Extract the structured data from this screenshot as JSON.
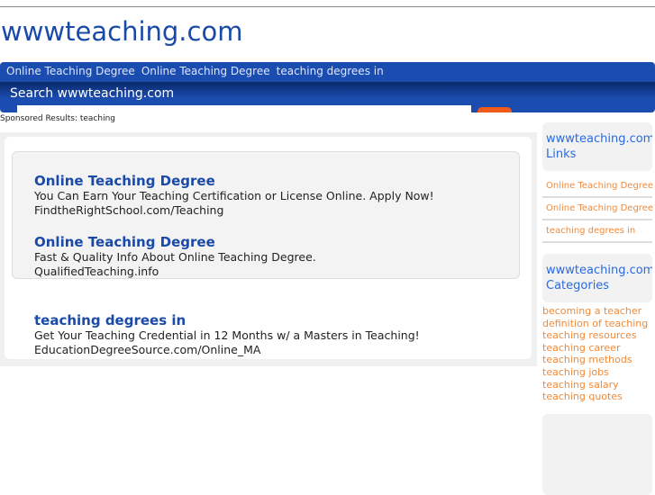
{
  "site_title": "wwwteaching.com",
  "nav": [
    "Online Teaching Degree",
    "Online Teaching Degree",
    "teaching degrees in"
  ],
  "search": {
    "label": "Search wwwteaching.com",
    "value": ""
  },
  "sponsored": "Sponsored Results: teaching",
  "ads": [
    {
      "title": "Online Teaching Degree",
      "desc": "You Can Earn Your Teaching Certification or License Online. Apply Now!",
      "url": "FindtheRightSchool.com/Teaching"
    },
    {
      "title": "Online Teaching Degree",
      "desc": "Fast & Quality Info About Online Teaching Degree.",
      "url": "QualifiedTeaching.info"
    },
    {
      "title": "teaching degrees in",
      "desc": "Get Your Teaching Credential in 12 Months w/ a Masters in Teaching!",
      "url": "EducationDegreeSource.com/Online_MA"
    }
  ],
  "sidebar": {
    "links_head": [
      "wwwteaching.com",
      "Links"
    ],
    "links": [
      "Online Teaching Degree",
      "Online Teaching Degree",
      "teaching degrees in"
    ],
    "cat_head": [
      "wwwteaching.com",
      "Categories"
    ],
    "categories": [
      "becoming a teacher",
      "definition of teaching",
      "teaching resources",
      "teaching career",
      "teaching methods",
      "teaching jobs",
      "teaching salary",
      "teaching quotes"
    ]
  }
}
